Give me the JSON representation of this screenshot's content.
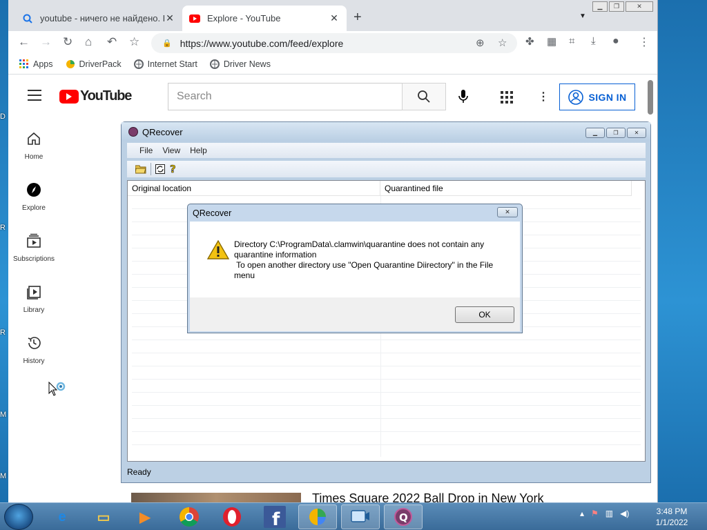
{
  "browser": {
    "tabs": [
      {
        "title": "youtube - ничего не найдено. П",
        "active": false
      },
      {
        "title": "Explore - YouTube",
        "active": true
      }
    ],
    "url": "https://www.youtube.com/feed/explore",
    "bookmarks": [
      "Apps",
      "DriverPack",
      "Internet Start",
      "Driver News"
    ]
  },
  "youtube": {
    "logo": "YouTube",
    "search_placeholder": "Search",
    "sign_in": "SIGN IN",
    "nav": [
      "Home",
      "Explore",
      "Subscriptions",
      "Library",
      "History"
    ],
    "video_title": "Times Square 2022 Ball Drop in New York"
  },
  "qrecover": {
    "title": "QRecover",
    "menu": [
      "File",
      "View",
      "Help"
    ],
    "columns": [
      "Original location",
      "Quarantined file"
    ],
    "status": "Ready"
  },
  "dialog": {
    "title": "QRecover",
    "message_lines": [
      "Directory C:\\ProgramData\\.clamwin\\quarantine does not contain any",
      "quarantine information",
      " To open another directory use \"Open Quarantine Diirectory\" in the File",
      "menu"
    ],
    "ok": "OK"
  },
  "taskbar": {
    "time": "3:48 PM",
    "date": "1/1/2022"
  },
  "colors": {
    "youtube_red": "#ff0000",
    "signin_blue": "#065fd4",
    "window_frame": "#bcd0e4",
    "desktop": "#1f7fc0"
  }
}
